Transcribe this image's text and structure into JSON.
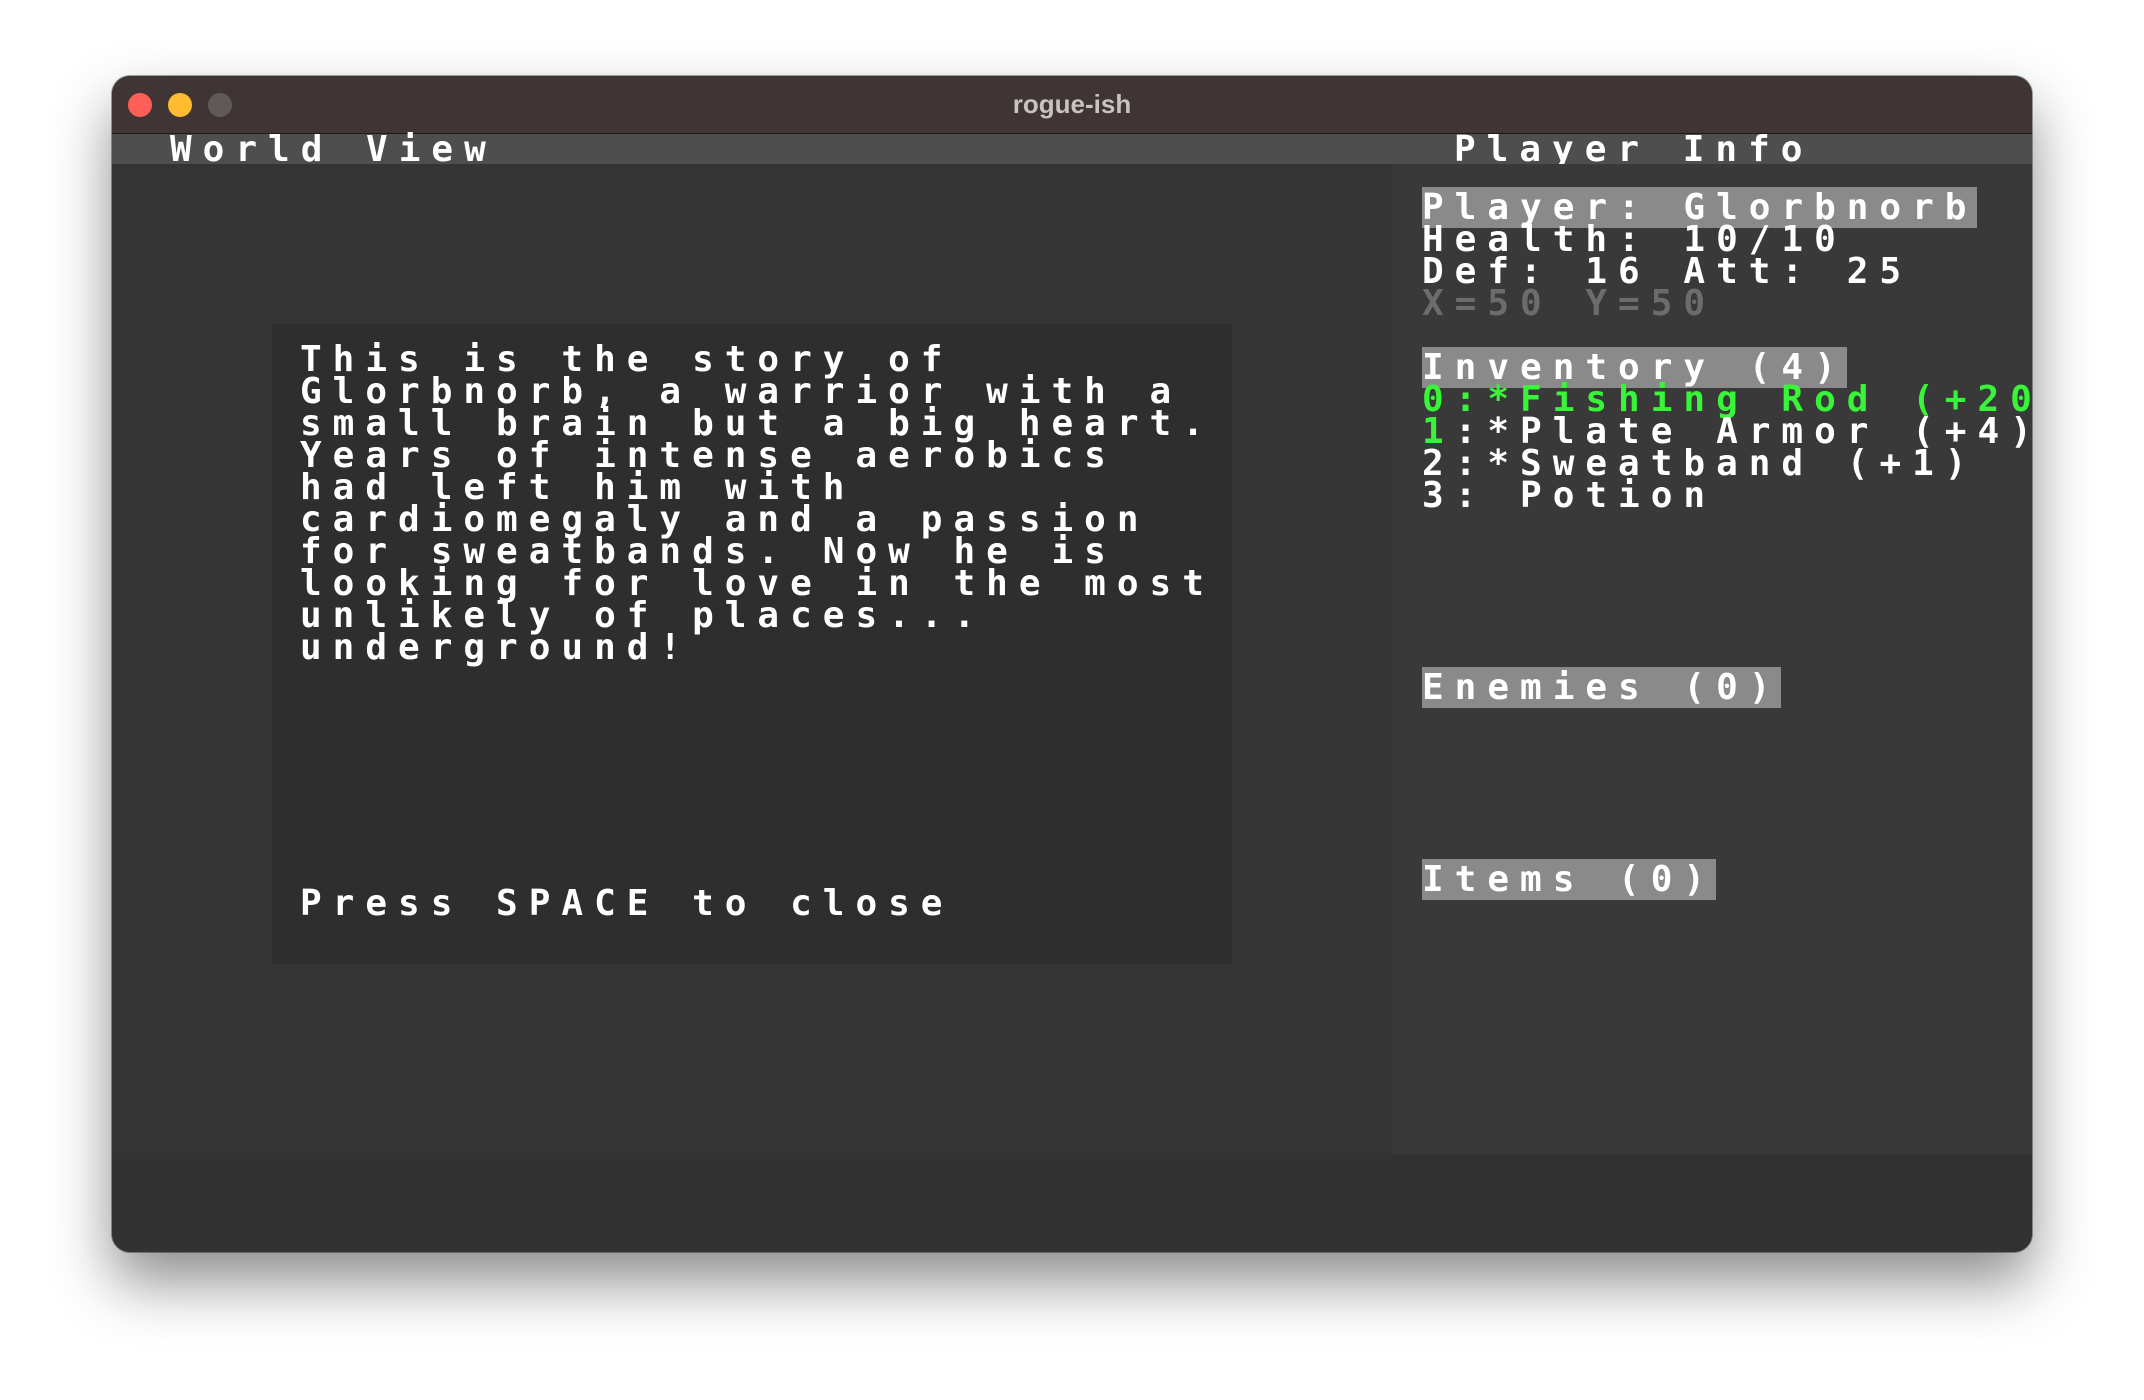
{
  "window": {
    "title": "rogue-ish"
  },
  "headers": {
    "world_view": "World View",
    "player_info": "Player Info"
  },
  "dialog": {
    "story_lines": [
      "This is the story of",
      "Glorbnorb, a warrior with a",
      "small brain but a big heart.",
      "Years of intense aerobics",
      "had left him with",
      "cardiomegaly and a passion",
      "for sweatbands. Now he is",
      "looking for love in the most",
      "unlikely of places...",
      "underground!"
    ],
    "close_hint": "Press SPACE to close"
  },
  "player": {
    "name_line": "Player: Glorbnorb",
    "health_line": "Health: 10/10",
    "stats_line": "Def: 16 Att: 25",
    "coords_line": "X=50 Y=50"
  },
  "inventory": {
    "title": "Inventory (4)",
    "items": [
      {
        "index": "0",
        "text": ":*Fishing Rod (+20"
      },
      {
        "index": "1",
        "text": ":*Plate Armor (+4)"
      },
      {
        "index": "2",
        "text": ":*Sweatband (+1)"
      },
      {
        "index": "3",
        "text": ": Potion"
      }
    ]
  },
  "enemies": {
    "title": "Enemies (0)"
  },
  "items_section": {
    "title": "Items (0)"
  },
  "colors": {
    "selected_item": "#39f539",
    "highlight_bg": "#8a8a8a",
    "coords_text": "#6c6c6c"
  }
}
